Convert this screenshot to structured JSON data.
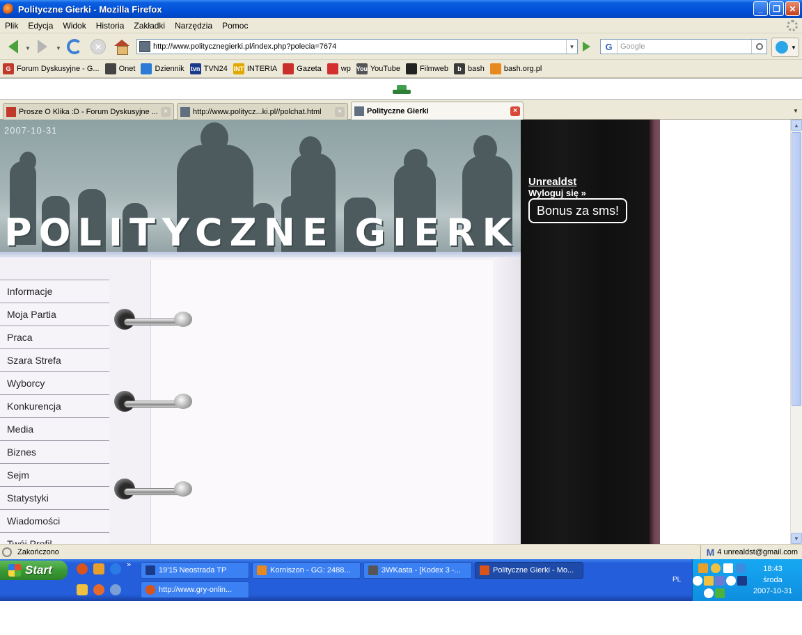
{
  "window": {
    "title": "Polityczne Gierki - Mozilla Firefox"
  },
  "menu": [
    "Plik",
    "Edycja",
    "Widok",
    "Historia",
    "Zakładki",
    "Narzędzia",
    "Pomoc"
  ],
  "nav": {
    "url": "http://www.politycznegierki.pl/index.php?polecia=7674",
    "search_placeholder": "Google",
    "search_engine_glyph": "G"
  },
  "bookmarks": [
    {
      "label": "Forum Dyskusyjne - G...",
      "icon": "g-forum-icon",
      "color": "#c0392b",
      "glyph": "G"
    },
    {
      "label": "Onet",
      "icon": "onet-icon",
      "color": "#444444",
      "glyph": ""
    },
    {
      "label": "Dziennik",
      "icon": "globe-icon",
      "color": "#2b7bd6",
      "glyph": ""
    },
    {
      "label": "TVN24",
      "icon": "tvn-icon",
      "color": "#1a3a8a",
      "glyph": "tvn"
    },
    {
      "label": "INTERIA",
      "icon": "interia-icon",
      "color": "#e0a800",
      "glyph": "INT"
    },
    {
      "label": "Gazeta",
      "icon": "gazeta-icon",
      "color": "#c9302c",
      "glyph": ""
    },
    {
      "label": "wp",
      "icon": "wp-icon",
      "color": "#d32f2f",
      "glyph": ""
    },
    {
      "label": "YouTube",
      "icon": "youtube-icon",
      "color": "#555555",
      "glyph": "You"
    },
    {
      "label": "Filmweb",
      "icon": "film-reel-icon",
      "color": "#222222",
      "glyph": ""
    },
    {
      "label": "bash",
      "icon": "bash-icon",
      "color": "#3a3a3a",
      "glyph": "b"
    },
    {
      "label": "bash.org.pl",
      "icon": "rss-icon",
      "color": "#e8891f",
      "glyph": ""
    }
  ],
  "tabs": [
    {
      "label": "Prosze O Klika :D - Forum Dyskusyjne ...",
      "active": false
    },
    {
      "label": "http://www.politycz...ki.pl//polchat.html",
      "active": false
    },
    {
      "label": "Polityczne Gierki",
      "active": true
    }
  ],
  "page": {
    "date": "2007-10-31",
    "logo_text": "POLITYCZNE GIERKI",
    "menu_items": [
      "Informacje",
      "Moja Partia",
      "Praca",
      "Szara Strefa",
      "Wyborcy",
      "Konkurencja",
      "Media",
      "Biznes",
      "Sejm",
      "Statystyki",
      "Wiadomości",
      "Twój Profil"
    ],
    "user": {
      "name": "Unrealdst",
      "logout": "Wyloguj się »",
      "bonus_button": "Bonus za sms!"
    }
  },
  "status": {
    "text": "Zakończono",
    "mail": "4 unrealdst@gmail.com"
  },
  "taskbar": {
    "start_label": "Start",
    "buttons_row1": [
      {
        "label": "19'15 Neostrada TP",
        "active": false,
        "color": "#1c3a8a"
      },
      {
        "label": "Korniszon - GG: 2488...",
        "active": false,
        "color": "#e8891f"
      },
      {
        "label": "3WKasta - [Kodex 3 -...",
        "active": false,
        "color": "#555555"
      },
      {
        "label": "Polityczne Gierki - Mo...",
        "active": true,
        "color": "#d9541a"
      }
    ],
    "buttons_row2": [
      {
        "label": "http://www.gry-onlin...",
        "active": false,
        "color": "#d9541a"
      }
    ],
    "lang": "PL",
    "clock": {
      "time": "18:43",
      "day": "środa",
      "date": "2007-10-31"
    }
  },
  "colors": {
    "xp_blue": "#245edb",
    "start_green": "#3c9b35",
    "dark_panel": "#111111"
  }
}
